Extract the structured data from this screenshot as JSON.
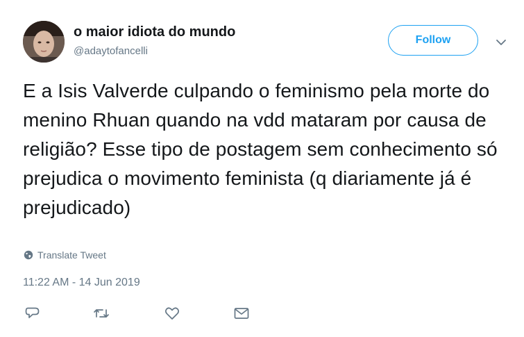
{
  "author": {
    "display_name": "o maior idiota do mundo",
    "handle": "@adaytofancelli",
    "avatar": "avatar-photo"
  },
  "follow_button": {
    "label": "Follow"
  },
  "menu": {
    "icon": "chevron-down-icon"
  },
  "tweet": {
    "text": "E a Isis Valverde culpando o feminismo pela morte do menino Rhuan quando na vdd mataram por causa de religião? Esse tipo de postagem sem conhecimento só prejudica o movimento feminista (q diariamente já é prejudicado)",
    "translate_label": "Translate Tweet",
    "timestamp": "11:22 AM - 14 Jun 2019"
  },
  "actions": [
    {
      "icon": "reply-icon"
    },
    {
      "icon": "retweet-icon"
    },
    {
      "icon": "like-icon"
    },
    {
      "icon": "direct-message-icon"
    }
  ],
  "colors": {
    "accent": "#1da1f2",
    "secondary_text": "#657786",
    "primary_text": "#14171a"
  }
}
